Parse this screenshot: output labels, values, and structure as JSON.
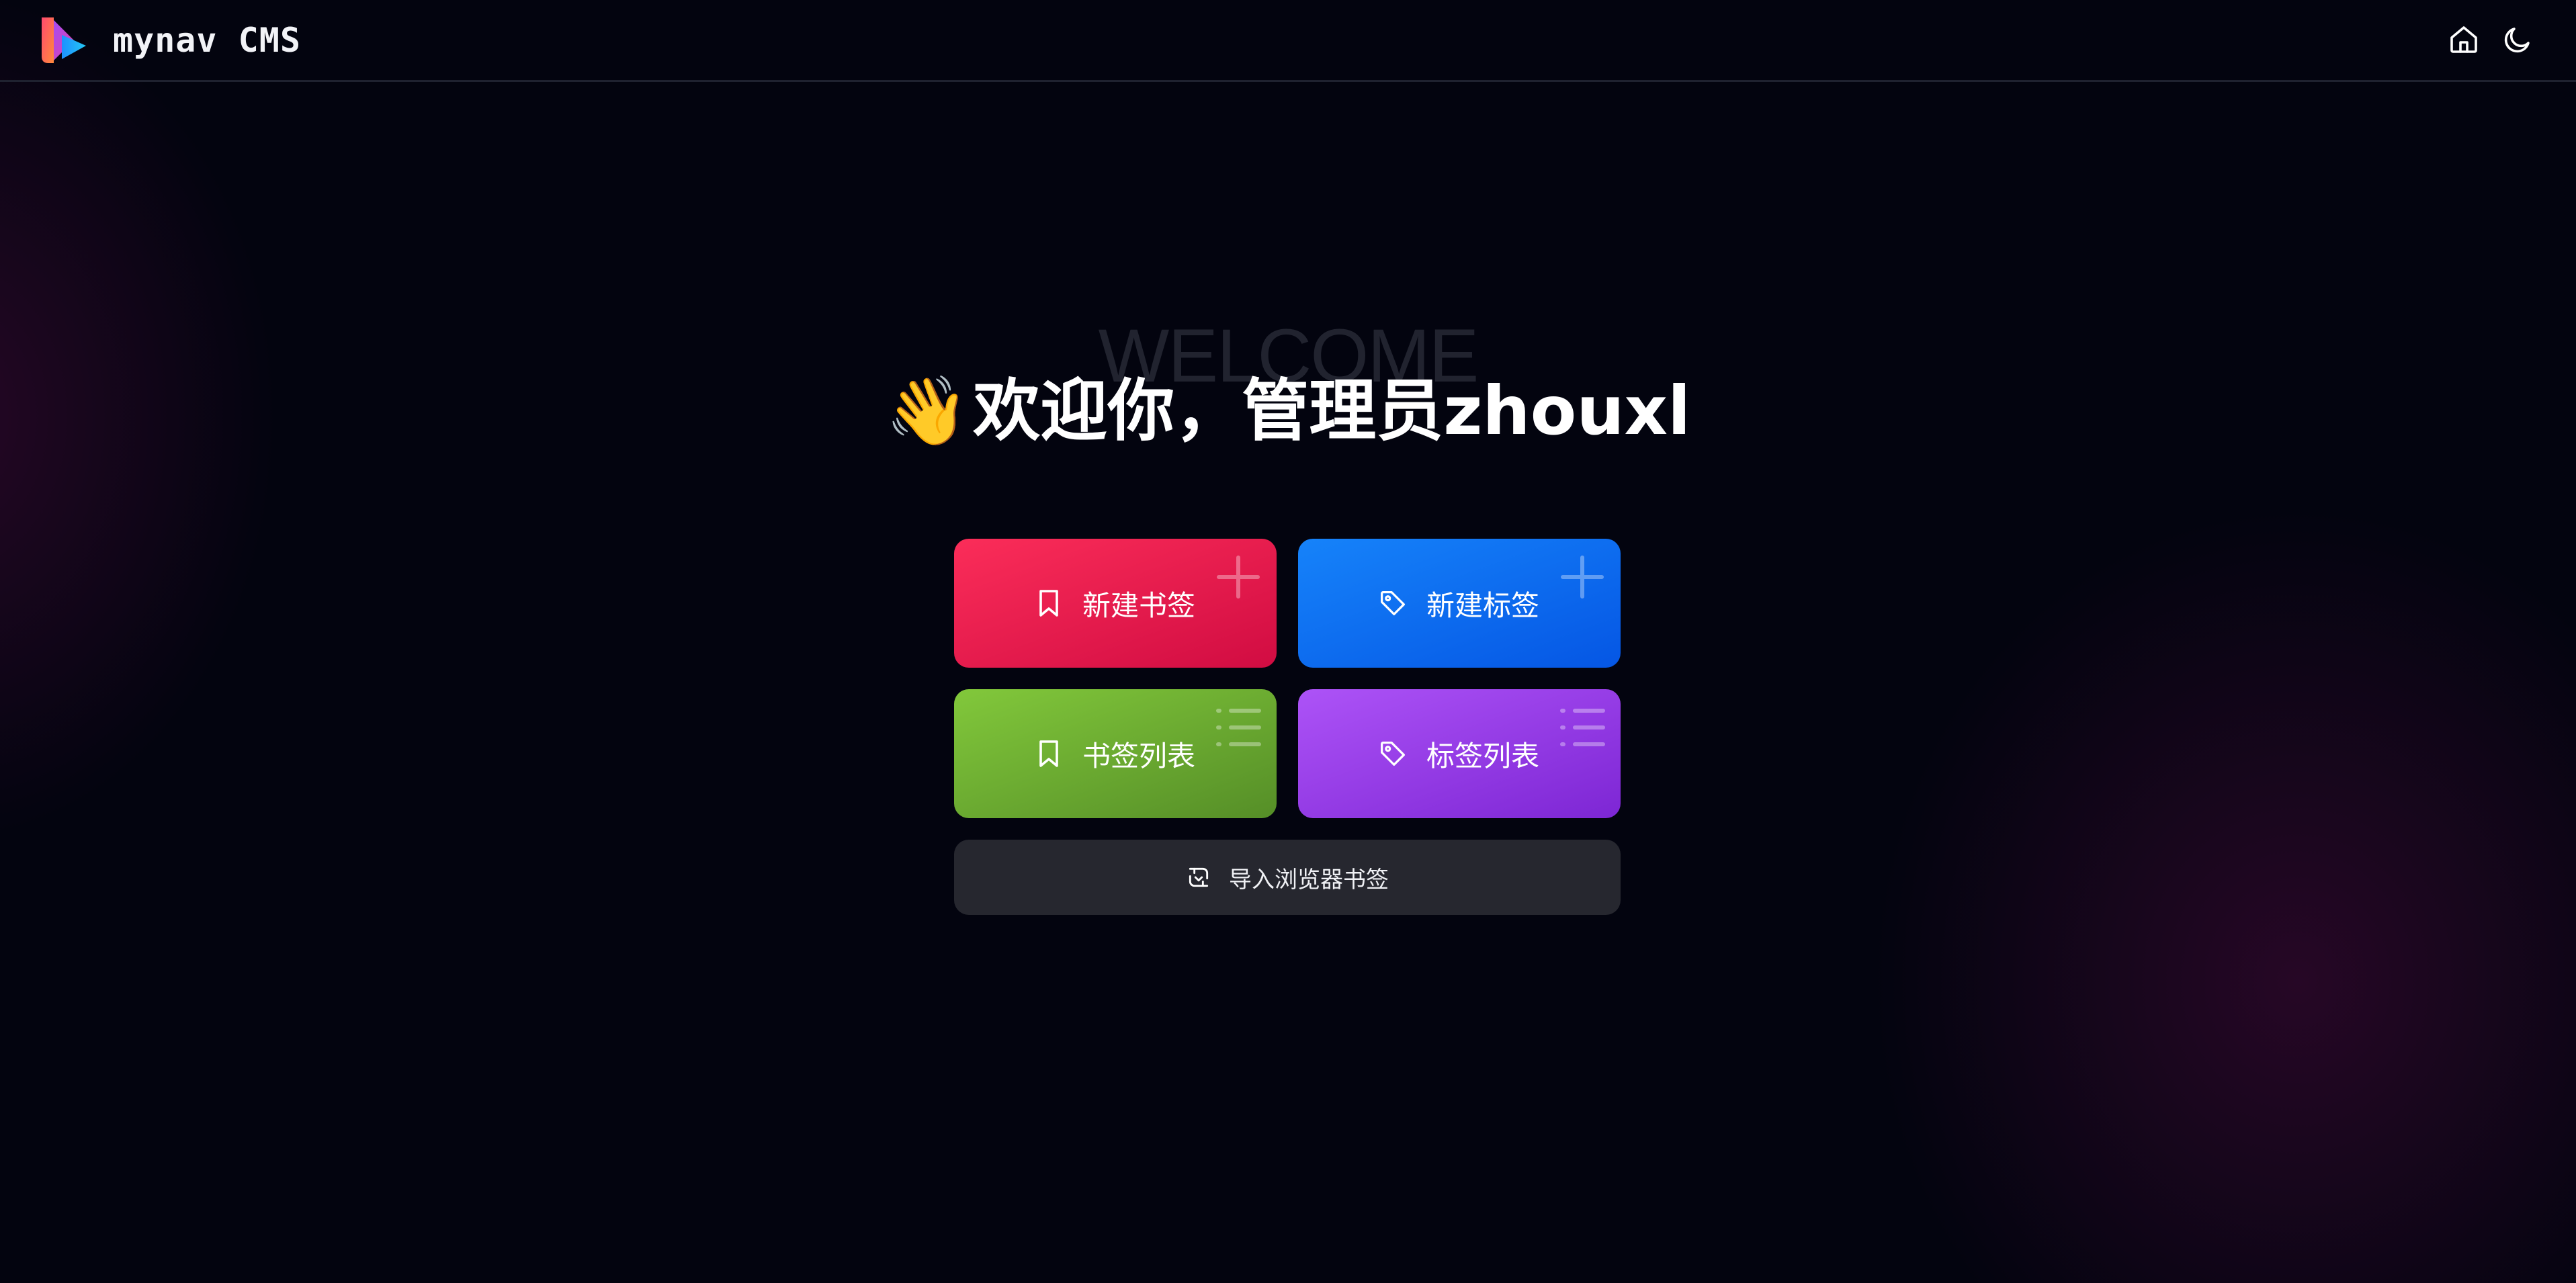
{
  "app": {
    "brand_name": "mynav CMS"
  },
  "nav": {
    "home_icon": "home-icon",
    "theme_icon": "moon-icon"
  },
  "hero": {
    "watermark": "WELCOME",
    "wave_emoji": "👋",
    "greeting": "欢迎你，管理员zhouxl"
  },
  "actions": {
    "new_bookmark": {
      "label": "新建书签",
      "icon": "bookmark-icon",
      "corner_icon": "plus-icon",
      "color": "#e81a4f"
    },
    "new_tag": {
      "label": "新建标签",
      "icon": "tag-icon",
      "corner_icon": "plus-icon",
      "color": "#0d6cf0"
    },
    "bookmark_list": {
      "label": "书签列表",
      "icon": "bookmark-icon",
      "corner_icon": "list-icon",
      "color": "#6dae31"
    },
    "tag_list": {
      "label": "标签列表",
      "icon": "tag-icon",
      "corner_icon": "list-icon",
      "color": "#963ee6"
    },
    "import_browser": {
      "label": "导入浏览器书签",
      "icon": "import-icon"
    }
  },
  "colors": {
    "background": "#03040f",
    "import_button": "#26272f"
  }
}
